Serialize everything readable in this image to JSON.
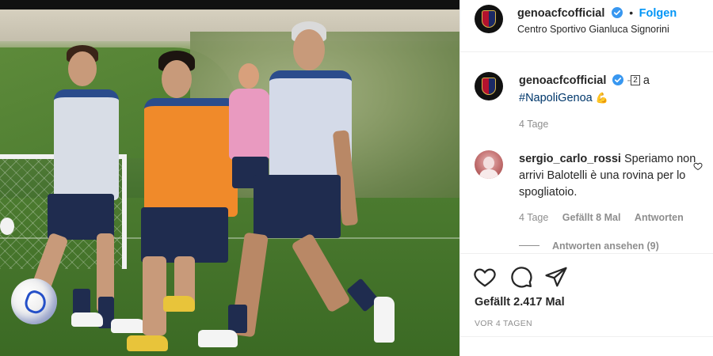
{
  "post": {
    "account": "genoacfcofficial",
    "follow_label": "Folgen",
    "separator": "•",
    "location": "Centro Sportivo Gianluca Signorini"
  },
  "caption": {
    "account": "genoacfcofficial",
    "mention_count": "2",
    "text_after_mention": "a",
    "hashtag": "#NapoliGenoa",
    "emoji": "💪",
    "time": "4 Tage"
  },
  "comment": {
    "user": "sergio_carlo_rossi",
    "text": "Speriamo non arrivi Balotelli è una rovina per lo spogliatoio.",
    "time": "4 Tage",
    "likes": "Gefällt 8 Mal",
    "reply_label": "Antworten",
    "view_replies": "Antworten ansehen (9)"
  },
  "actions": {
    "like_icon": "heart-icon",
    "comment_icon": "comment-icon",
    "share_icon": "send-icon",
    "likes_text": "Gefällt 2.417 Mal",
    "posted_ago": "VOR 4 TAGEN"
  },
  "colors": {
    "link_blue": "#0095f6",
    "hashtag_blue": "#00376b",
    "muted": "#8e8e8e",
    "text": "#262626"
  }
}
